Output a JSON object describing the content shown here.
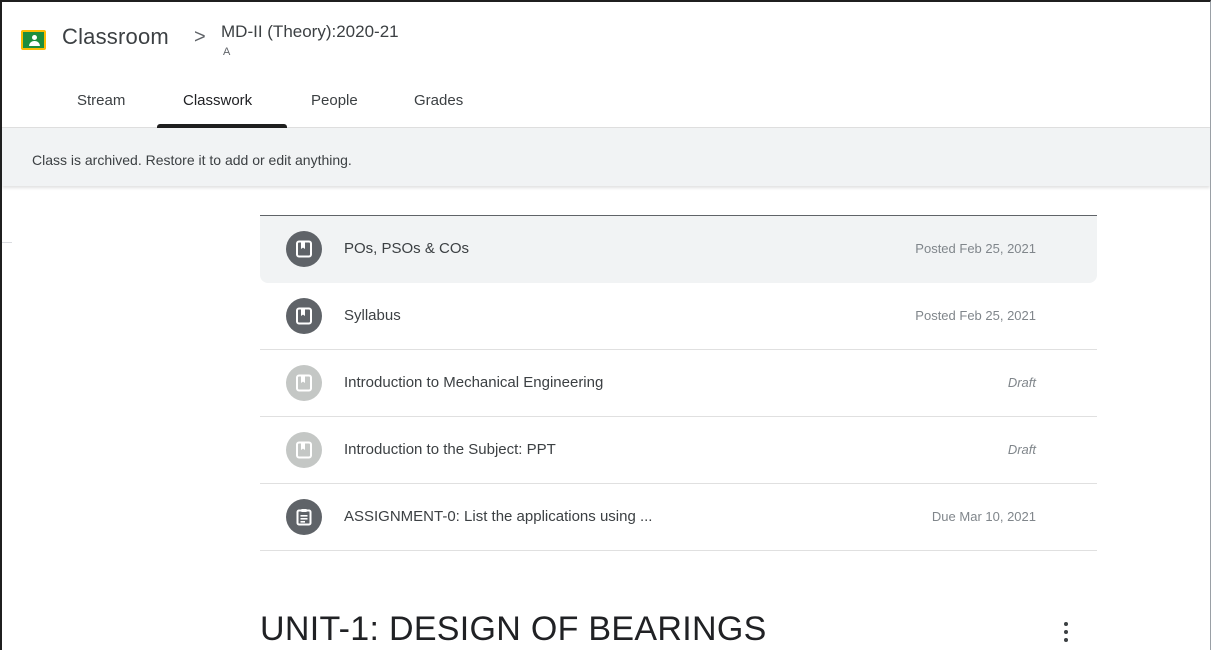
{
  "header": {
    "app_title": "Classroom",
    "separator": ">",
    "class_name": "MD-II (Theory):2020-21",
    "class_section": "A"
  },
  "tabs": [
    {
      "label": "Stream"
    },
    {
      "label": "Classwork"
    },
    {
      "label": "People"
    },
    {
      "label": "Grades"
    }
  ],
  "active_tab": "Classwork",
  "banner": {
    "text": "Class is archived. Restore it to add or edit anything."
  },
  "items": [
    {
      "title": "POs, PSOs & COs",
      "meta": "Posted Feb 25, 2021",
      "icon": "material-icon",
      "state": "posted"
    },
    {
      "title": "Syllabus",
      "meta": "Posted Feb 25, 2021",
      "icon": "material-icon",
      "state": "posted"
    },
    {
      "title": "Introduction to Mechanical Engineering",
      "meta": "Draft",
      "icon": "material-icon",
      "state": "draft"
    },
    {
      "title": "Introduction to the Subject: PPT",
      "meta": "Draft",
      "icon": "material-icon",
      "state": "draft"
    },
    {
      "title": "ASSIGNMENT-0: List the applications using ...",
      "meta": "Due Mar 10, 2021",
      "icon": "assignment-icon",
      "state": "assigned"
    }
  ],
  "topic": {
    "title": "UNIT-1: DESIGN OF BEARINGS"
  },
  "colors": {
    "brand_green": "#1e8e3e",
    "brand_yellow": "#fbbc04",
    "icon_dark": "#5f6368",
    "icon_draft": "#c4c7c5",
    "banner_bg": "#f1f3f4"
  }
}
